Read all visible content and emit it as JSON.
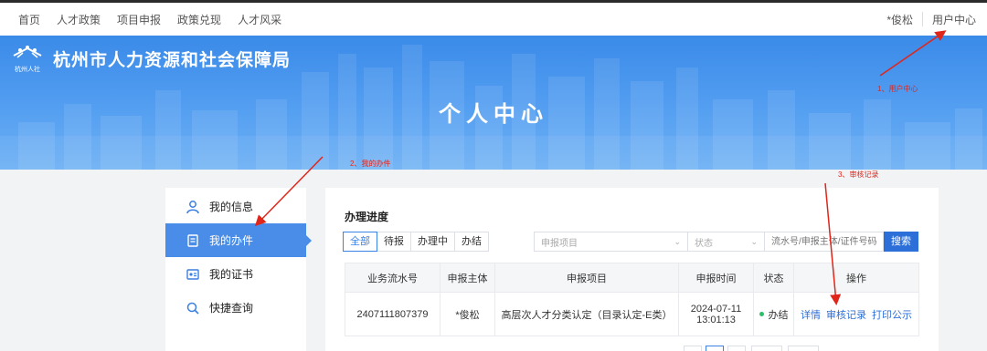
{
  "topnav": {
    "links": [
      "首页",
      "人才政策",
      "项目申报",
      "政策兑现",
      "人才风采"
    ],
    "username": "*俊松",
    "user_center": "用户中心"
  },
  "banner": {
    "logo_text": "杭州人社",
    "org_name": "杭州市人力资源和社会保障局",
    "title": "个人中心"
  },
  "sidebar": {
    "items": [
      {
        "label": "我的信息",
        "icon": "user-icon"
      },
      {
        "label": "我的办件",
        "icon": "document-icon"
      },
      {
        "label": "我的证书",
        "icon": "certificate-icon"
      },
      {
        "label": "快捷查询",
        "icon": "search-icon"
      }
    ],
    "active_index": 1
  },
  "progress": {
    "title": "办理进度",
    "tabs": [
      "全部",
      "待报",
      "办理中",
      "办结"
    ],
    "active_tab": 0,
    "filter_project_placeholder": "申报项目",
    "filter_status_placeholder": "状态",
    "search_placeholder": "流水号/申报主体/证件号码",
    "search_button": "搜索",
    "columns": [
      "业务流水号",
      "申报主体",
      "申报项目",
      "申报时间",
      "状态",
      "操作"
    ],
    "rows": [
      {
        "serial": "2407111807379",
        "applicant": "*俊松",
        "project": "高层次人才分类认定（目录认定-E类）",
        "date": "2024-07-11",
        "time": "13:01:13",
        "status": "办结",
        "actions": [
          "详情",
          "审核记录",
          "打印公示"
        ]
      }
    ]
  },
  "annotations": {
    "step1": "1、用户中心",
    "step2": "2、我的办件",
    "step3": "3、审核记录",
    "color": "#e0261b"
  },
  "colors": {
    "accent": "#4a8de8",
    "button": "#2d6fd9",
    "status_done": "#2bbf6a"
  }
}
